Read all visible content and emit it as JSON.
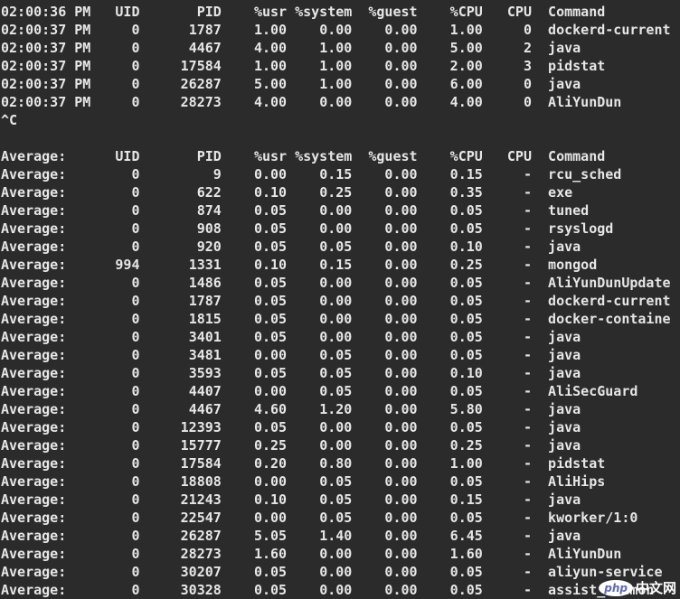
{
  "headers1": [
    "02:00:36 PM",
    "UID",
    "PID",
    "%usr",
    "%system",
    "%guest",
    "%CPU",
    "CPU",
    "Command"
  ],
  "rows1": [
    [
      "02:00:37 PM",
      "0",
      "1787",
      "1.00",
      "0.00",
      "0.00",
      "1.00",
      "0",
      "dockerd-current"
    ],
    [
      "02:00:37 PM",
      "0",
      "4467",
      "4.00",
      "1.00",
      "0.00",
      "5.00",
      "2",
      "java"
    ],
    [
      "02:00:37 PM",
      "0",
      "17584",
      "1.00",
      "1.00",
      "0.00",
      "2.00",
      "3",
      "pidstat"
    ],
    [
      "02:00:37 PM",
      "0",
      "26287",
      "5.00",
      "1.00",
      "0.00",
      "6.00",
      "0",
      "java"
    ],
    [
      "02:00:37 PM",
      "0",
      "28273",
      "4.00",
      "0.00",
      "0.00",
      "4.00",
      "0",
      "AliYunDun"
    ]
  ],
  "interrupt": "^C",
  "headers2": [
    "Average:",
    "UID",
    "PID",
    "%usr",
    "%system",
    "%guest",
    "%CPU",
    "CPU",
    "Command"
  ],
  "rows2": [
    [
      "Average:",
      "0",
      "9",
      "0.00",
      "0.15",
      "0.00",
      "0.15",
      "-",
      "rcu_sched"
    ],
    [
      "Average:",
      "0",
      "622",
      "0.10",
      "0.25",
      "0.00",
      "0.35",
      "-",
      "exe"
    ],
    [
      "Average:",
      "0",
      "874",
      "0.05",
      "0.00",
      "0.00",
      "0.05",
      "-",
      "tuned"
    ],
    [
      "Average:",
      "0",
      "908",
      "0.05",
      "0.00",
      "0.00",
      "0.05",
      "-",
      "rsyslogd"
    ],
    [
      "Average:",
      "0",
      "920",
      "0.05",
      "0.05",
      "0.00",
      "0.10",
      "-",
      "java"
    ],
    [
      "Average:",
      "994",
      "1331",
      "0.10",
      "0.15",
      "0.00",
      "0.25",
      "-",
      "mongod"
    ],
    [
      "Average:",
      "0",
      "1486",
      "0.05",
      "0.00",
      "0.00",
      "0.05",
      "-",
      "AliYunDunUpdate"
    ],
    [
      "Average:",
      "0",
      "1787",
      "0.05",
      "0.00",
      "0.00",
      "0.05",
      "-",
      "dockerd-current"
    ],
    [
      "Average:",
      "0",
      "1815",
      "0.05",
      "0.00",
      "0.00",
      "0.05",
      "-",
      "docker-containe"
    ],
    [
      "Average:",
      "0",
      "3401",
      "0.05",
      "0.00",
      "0.00",
      "0.05",
      "-",
      "java"
    ],
    [
      "Average:",
      "0",
      "3481",
      "0.00",
      "0.05",
      "0.00",
      "0.05",
      "-",
      "java"
    ],
    [
      "Average:",
      "0",
      "3593",
      "0.05",
      "0.05",
      "0.00",
      "0.10",
      "-",
      "java"
    ],
    [
      "Average:",
      "0",
      "4407",
      "0.00",
      "0.05",
      "0.00",
      "0.05",
      "-",
      "AliSecGuard"
    ],
    [
      "Average:",
      "0",
      "4467",
      "4.60",
      "1.20",
      "0.00",
      "5.80",
      "-",
      "java"
    ],
    [
      "Average:",
      "0",
      "12393",
      "0.05",
      "0.00",
      "0.00",
      "0.05",
      "-",
      "java"
    ],
    [
      "Average:",
      "0",
      "15777",
      "0.25",
      "0.00",
      "0.00",
      "0.25",
      "-",
      "java"
    ],
    [
      "Average:",
      "0",
      "17584",
      "0.20",
      "0.80",
      "0.00",
      "1.00",
      "-",
      "pidstat"
    ],
    [
      "Average:",
      "0",
      "18808",
      "0.00",
      "0.05",
      "0.00",
      "0.05",
      "-",
      "AliHips"
    ],
    [
      "Average:",
      "0",
      "21243",
      "0.10",
      "0.05",
      "0.00",
      "0.15",
      "-",
      "java"
    ],
    [
      "Average:",
      "0",
      "22547",
      "0.00",
      "0.05",
      "0.00",
      "0.05",
      "-",
      "kworker/1:0"
    ],
    [
      "Average:",
      "0",
      "26287",
      "5.05",
      "1.40",
      "0.00",
      "6.45",
      "-",
      "java"
    ],
    [
      "Average:",
      "0",
      "28273",
      "1.60",
      "0.00",
      "0.00",
      "1.60",
      "-",
      "AliYunDun"
    ],
    [
      "Average:",
      "0",
      "30207",
      "0.05",
      "0.00",
      "0.00",
      "0.05",
      "-",
      "aliyun-service"
    ],
    [
      "Average:",
      "0",
      "30328",
      "0.05",
      "0.00",
      "0.00",
      "0.05",
      "-",
      "assist_daemon"
    ]
  ],
  "watermark": {
    "logo": "php",
    "text": "中文网"
  }
}
